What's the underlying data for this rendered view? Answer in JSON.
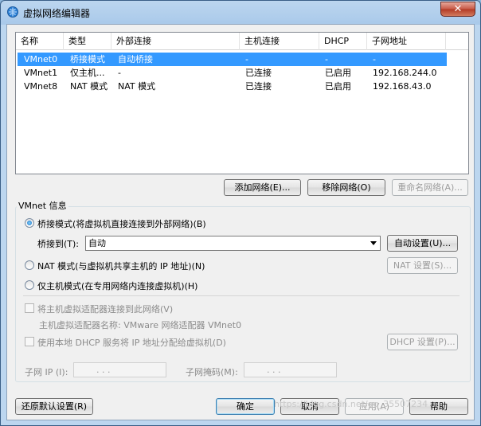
{
  "window": {
    "title": "虚拟网络编辑器",
    "close_label": "✕"
  },
  "list": {
    "columns": [
      "名称",
      "类型",
      "外部连接",
      "主机连接",
      "DHCP",
      "子网地址"
    ],
    "rows": [
      [
        "VMnet0",
        "桥接模式",
        "自动桥接",
        "-",
        "-",
        "-"
      ],
      [
        "VMnet1",
        "仅主机...",
        "-",
        "已连接",
        "已启用",
        "192.168.244.0"
      ],
      [
        "VMnet8",
        "NAT 模式",
        "NAT 模式",
        "已连接",
        "已启用",
        "192.168.43.0"
      ]
    ]
  },
  "list_buttons": {
    "add": "添加网络(E)...",
    "remove": "移除网络(O)",
    "rename": "重命名网络(A)..."
  },
  "vmnet_info": {
    "title": "VMnet 信息",
    "bridged_label": "桥接模式(将虚拟机直接连接到外部网络)(B)",
    "bridge_to_label": "桥接到(T):",
    "bridge_to_value": "自动",
    "auto_settings": "自动设置(U)...",
    "nat_label": "NAT 模式(与虚拟机共享主机的 IP 地址)(N)",
    "nat_settings": "NAT 设置(S)...",
    "hostonly_label": "仅主机模式(在专用网络内连接虚拟机)(H)",
    "connect_adapter_label": "将主机虚拟适配器连接到此网络(V)",
    "adapter_name_label": "主机虚拟适配器名称: VMware 网络适配器 VMnet0",
    "dhcp_label": "使用本地 DHCP 服务将 IP 地址分配给虚拟机(D)",
    "dhcp_settings": "DHCP 设置(P)...",
    "subnet_ip_label": "子网 IP (I):",
    "subnet_mask_label": "子网掩码(M):",
    "ip_dots": ".      .      ."
  },
  "footer": {
    "restore": "还原默认设置(R)",
    "ok": "确定",
    "cancel": "取消",
    "apply": "应用(A)",
    "help": "帮助"
  },
  "watermark": "https://blog.csdn.net/qq_35507234"
}
